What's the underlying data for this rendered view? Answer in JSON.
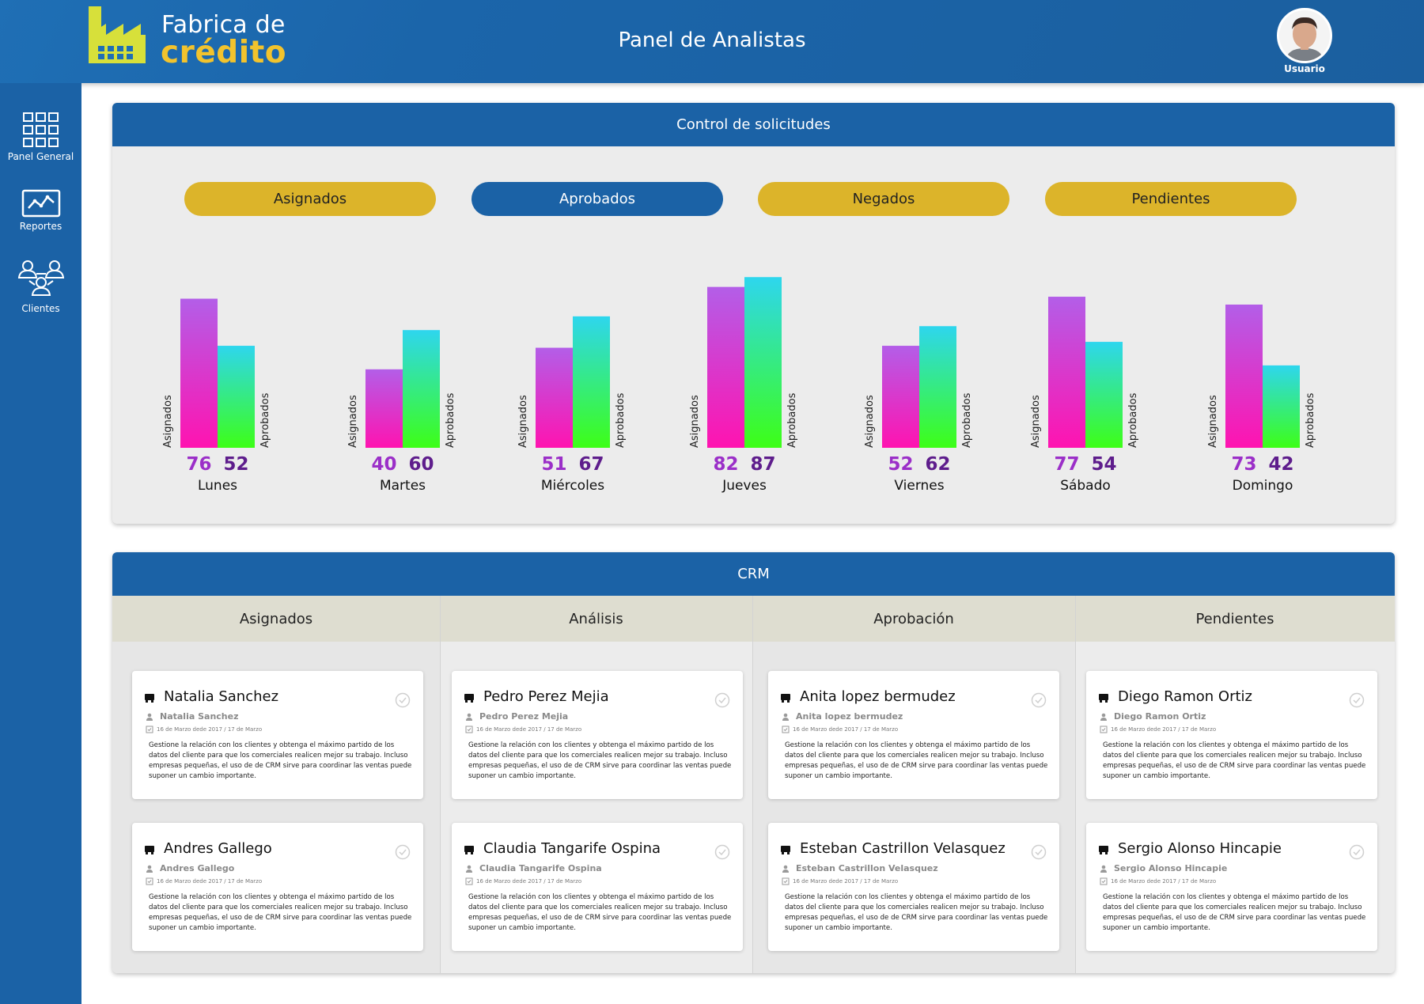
{
  "header": {
    "logo_line1": "Fabrica de",
    "logo_line2": "crédito",
    "title": "Panel de Analistas",
    "user_label": "Usuario"
  },
  "sidebar": {
    "items": [
      {
        "label": "Panel General",
        "icon": "grid-icon"
      },
      {
        "label": "Reportes",
        "icon": "chart-line-icon"
      },
      {
        "label": "Clientes",
        "icon": "users-icon"
      }
    ]
  },
  "requests_panel": {
    "title": "Control de solicitudes",
    "pills": [
      {
        "label": "Asignados",
        "color": "#dcb42a"
      },
      {
        "label": "Aprobados",
        "color": "#1b62a6"
      },
      {
        "label": "Negados",
        "color": "#dcb42a"
      },
      {
        "label": "Pendientes",
        "color": "#dcb42a"
      }
    ]
  },
  "chart_data": {
    "type": "bar",
    "categories": [
      "Lunes",
      "Martes",
      "Miércoles",
      "Jueves",
      "Viernes",
      "Sábado",
      "Domingo"
    ],
    "series": [
      {
        "name": "Asignados",
        "values": [
          76,
          40,
          51,
          82,
          52,
          77,
          73
        ],
        "color_top": "#b35ee8",
        "color_bottom": "#ff13b0",
        "label_color": "#9b2fc8"
      },
      {
        "name": "Aprobados",
        "values": [
          52,
          60,
          67,
          87,
          62,
          54,
          42
        ],
        "color_top": "#2ed6ee",
        "color_bottom": "#3dff16",
        "label_color": "#5e1d8c"
      }
    ],
    "ylim": [
      0,
      100
    ],
    "grid": false,
    "legend": "none"
  },
  "crm": {
    "title": "CRM",
    "description": "Gestione la relación con los clientes y obtenga  el máximo partido de los datos del cliente para que los comerciales realicen mejor su trabajo. Incluso empresas pequeñas, el uso de de CRM  sirve para coordinar las ventas puede suponer un cambio importante.",
    "date": "16 de Marzo dede 2017 / 17 de Marzo",
    "columns": [
      {
        "title": "Asignados",
        "cards": [
          "Natalia Sanchez",
          "Andres Gallego"
        ]
      },
      {
        "title": "Análisis",
        "cards": [
          "Pedro Perez Mejia",
          "Claudia Tangarife Ospina"
        ]
      },
      {
        "title": "Aprobación",
        "cards": [
          "Anita lopez bermudez",
          "Esteban Castrillon Velasquez"
        ]
      },
      {
        "title": "Pendientes",
        "cards": [
          "Diego Ramon Ortiz",
          "Sergio Alonso Hincapie"
        ]
      }
    ]
  }
}
